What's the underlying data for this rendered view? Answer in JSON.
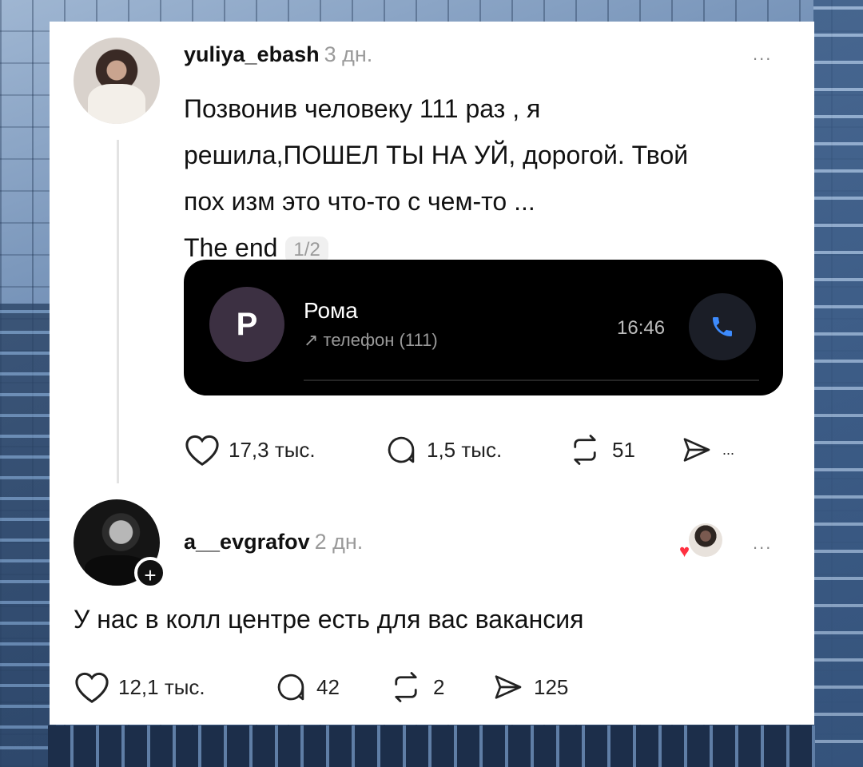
{
  "post": {
    "username": "yuliya_ebash",
    "time": "3 дн.",
    "more": "...",
    "text_lines": [
      "Позвонив человеку 111 раз , я",
      "решила,ПОШЕЛ ТЫ НА  УЙ, дорогой. Твой",
      "пох  изм это что-то с чем-то ...",
      "The end"
    ],
    "page_indicator": "1/2",
    "call": {
      "avatar_letter": "Р",
      "name": "Рома",
      "subtitle": "↗ телефон (111)",
      "time": "16:46"
    },
    "actions": {
      "likes": "17,3 тыс.",
      "comments": "1,5 тыс.",
      "reposts": "51",
      "share": "..."
    }
  },
  "reply": {
    "username": "a__evgrafov",
    "time": "2 дн.",
    "more": "...",
    "text": "У нас в колл центре есть для вас вакансия",
    "actions": {
      "likes": "12,1 тыс.",
      "comments": "42",
      "reposts": "2",
      "shares": "125"
    }
  },
  "colors": {
    "card_bg": "#ffffff",
    "call_card_bg": "#000000",
    "call_icon": "#3d8bfd",
    "liked_heart": "#ff3040"
  }
}
